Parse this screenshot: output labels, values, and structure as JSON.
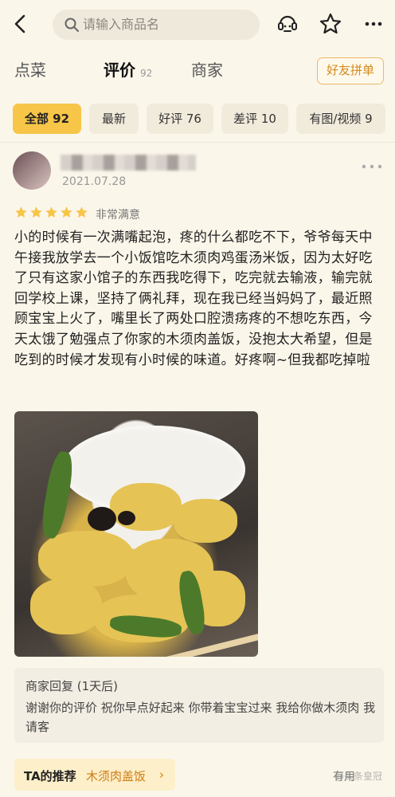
{
  "search": {
    "placeholder": "请输入商品名"
  },
  "tabs": [
    {
      "label": "点菜"
    },
    {
      "label": "评价",
      "count": "92"
    },
    {
      "label": "商家"
    }
  ],
  "friend_button": "好友拼单",
  "filters": [
    {
      "label": "全部 92",
      "active": true
    },
    {
      "label": "最新"
    },
    {
      "label": "好评 76"
    },
    {
      "label": "差评 10"
    },
    {
      "label": "有图/视频 9"
    }
  ],
  "review": {
    "date": "2021.07.28",
    "stars": 5,
    "rating_text": "非常满意",
    "text": "小的时候有一次满嘴起泡，疼的什么都吃不下，爷爷每天中午接我放学去一个小饭馆吃木须肉鸡蛋汤米饭，因为太好吃了只有这家小馆子的东西我吃得下，吃完就去输液，输完就回学校上课，坚持了俩礼拜，现在我已经当妈妈了，最近照顾宝宝上火了，嘴里长了两处口腔溃疡疼的不想吃东西，今天太饿了勉强点了你家的木须肉盖饭，没抱太大希望，但是吃到的时候才发现有小时候的味道。好疼啊~但我都吃掉啦"
  },
  "merchant_reply": {
    "title": "商家回复 (1天后)",
    "text": "谢谢你的评价 祝你早点好起来 你带着宝宝过来 我给你做木须肉 我请客"
  },
  "recommend": {
    "label": "TA的推荐",
    "dish": "木须肉盖饭",
    "chevron": "›"
  },
  "useful_label": "有用",
  "watermark": "@头条皇冠",
  "colors": {
    "accent": "#f7c548",
    "brand_orange": "#d07d12",
    "background": "#fbf6ea"
  }
}
